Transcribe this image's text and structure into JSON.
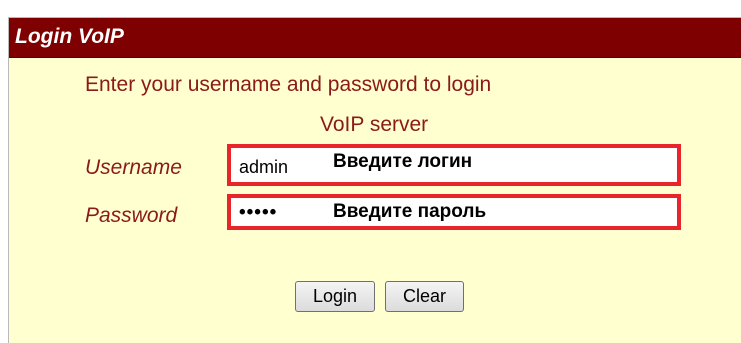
{
  "header": {
    "title": "Login VoIP"
  },
  "form": {
    "instruction": "Enter your username and password to login",
    "server_label": "VoIP server",
    "username": {
      "label": "Username",
      "value": "admin",
      "hint": "Введите логин"
    },
    "password": {
      "label": "Password",
      "value": "•••••",
      "hint": "Введите пароль"
    }
  },
  "buttons": {
    "login_label": "Login",
    "clear_label": "Clear"
  },
  "colors": {
    "title_bar": "#7e0000",
    "panel_background": "#ffffcf",
    "label_text": "#8b1a1a",
    "highlight_border": "#e8252a"
  }
}
